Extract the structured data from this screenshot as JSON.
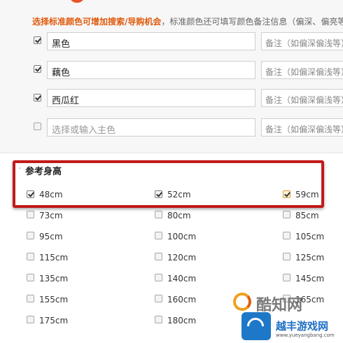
{
  "colors": {
    "accent": "#e05a0c",
    "highlight": "#c11a1a"
  },
  "color_section": {
    "hint_emphasis": "选择标准颜色可增加搜索/导购机会",
    "hint_rest": "，标准颜色还可填写颜色备注信息（偏深、偏亮等）",
    "note_placeholder": "备注（如偏深偏浅等）",
    "rows": [
      {
        "checked": true,
        "value": "黑色"
      },
      {
        "checked": true,
        "value": "藕色"
      },
      {
        "checked": true,
        "value": "西瓜红"
      },
      {
        "checked": false,
        "placeholder": "选择或输入主色"
      }
    ]
  },
  "height_section": {
    "title": "参考身高",
    "items": [
      {
        "label": "48cm",
        "checked": true
      },
      {
        "label": "52cm",
        "checked": true
      },
      {
        "label": "59cm",
        "checked": true
      },
      {
        "label": "73cm",
        "checked": false
      },
      {
        "label": "80cm",
        "checked": false
      },
      {
        "label": "85cm",
        "checked": false
      },
      {
        "label": "95cm",
        "checked": false
      },
      {
        "label": "100cm",
        "checked": false
      },
      {
        "label": "105cm",
        "checked": false
      },
      {
        "label": "115cm",
        "checked": false
      },
      {
        "label": "120cm",
        "checked": false
      },
      {
        "label": "125cm",
        "checked": false
      },
      {
        "label": "135cm",
        "checked": false
      },
      {
        "label": "140cm",
        "checked": false
      },
      {
        "label": "145cm",
        "checked": false
      },
      {
        "label": "155cm",
        "checked": false
      },
      {
        "label": "160cm",
        "checked": false
      },
      {
        "label": "165cm",
        "checked": false
      },
      {
        "label": "175cm",
        "checked": false
      },
      {
        "label": "180cm",
        "checked": false
      }
    ]
  },
  "watermarks": {
    "site1": "酷知网",
    "site2_title": "越丰游戏网",
    "site2_url": "www.yueyangbang.com"
  }
}
